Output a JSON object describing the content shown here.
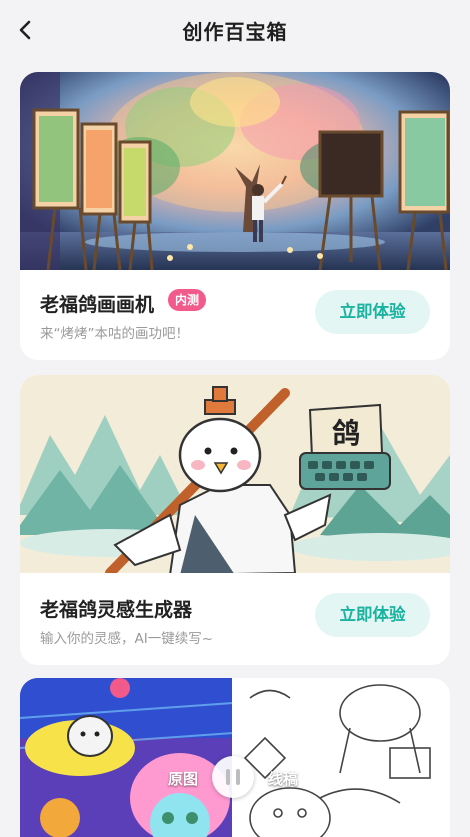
{
  "header": {
    "title": "创作百宝箱",
    "back_icon": "chevron-left-icon"
  },
  "cards": [
    {
      "title": "老福鸽画画机",
      "badge": "内测",
      "subtitle": "来“烤烤”本咕的画功吧！",
      "cta": "立即体验",
      "image": "painter-with-easels-illustration"
    },
    {
      "title": "老福鸽灵感生成器",
      "subtitle": "输入你的灵感，AI一键续写~",
      "cta": "立即体验",
      "image": "pigeon-with-typewriter-illustration",
      "typewriter_char": "鸽"
    }
  ],
  "compare": {
    "left_label": "原图",
    "right_label": "线稿",
    "handle_icon": "pause-icon"
  },
  "colors": {
    "accent_teal": "#19b3a0",
    "cta_bg": "#e3f6f4",
    "badge_pink": "#f25a8c",
    "page_bg": "#f3f3f5"
  }
}
